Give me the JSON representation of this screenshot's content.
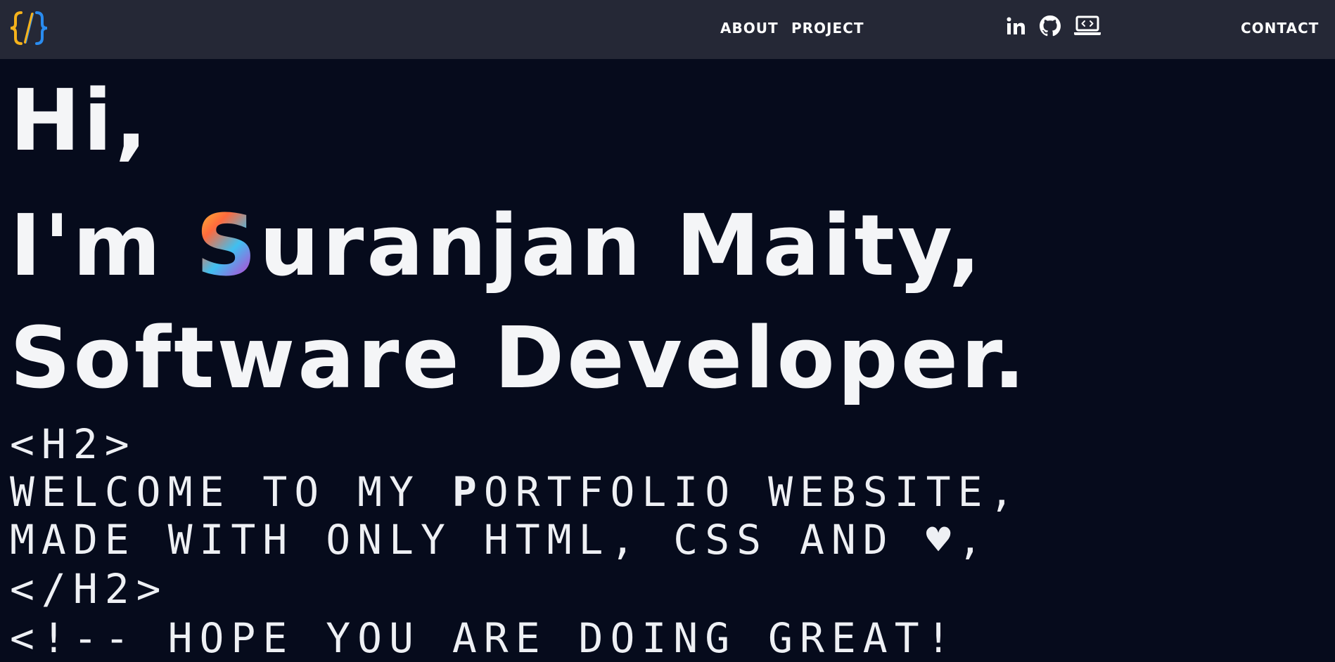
{
  "nav": {
    "about": "ABOUT",
    "project": "PROJECT",
    "contact": "CONTACT"
  },
  "social": [
    "linkedin-icon",
    "github-icon",
    "laptop-code-icon"
  ],
  "hero": {
    "line1": "Hi,",
    "line2_prefix": "I'm ",
    "line2_highlight": "S",
    "line2_suffix": "uranjan Maity,",
    "line3": "Software Developer."
  },
  "code": {
    "open_tag": "<H2>",
    "welcome_prefix": "WELCOME TO MY ",
    "welcome_bold": "P",
    "welcome_suffix": "ORTFOLIO WEBSITE,",
    "made_with": "MADE WITH ONLY HTML, CSS AND ♥,",
    "close_tag": "</H2>",
    "hope": "<!-- HOPE YOU ARE DOING GREAT!"
  },
  "colors": {
    "background": "#060b1c",
    "navbar": "#252836",
    "text": "#f4f5f7",
    "logo_yellow": "#f5b21b",
    "logo_blue": "#2a8cf0"
  }
}
